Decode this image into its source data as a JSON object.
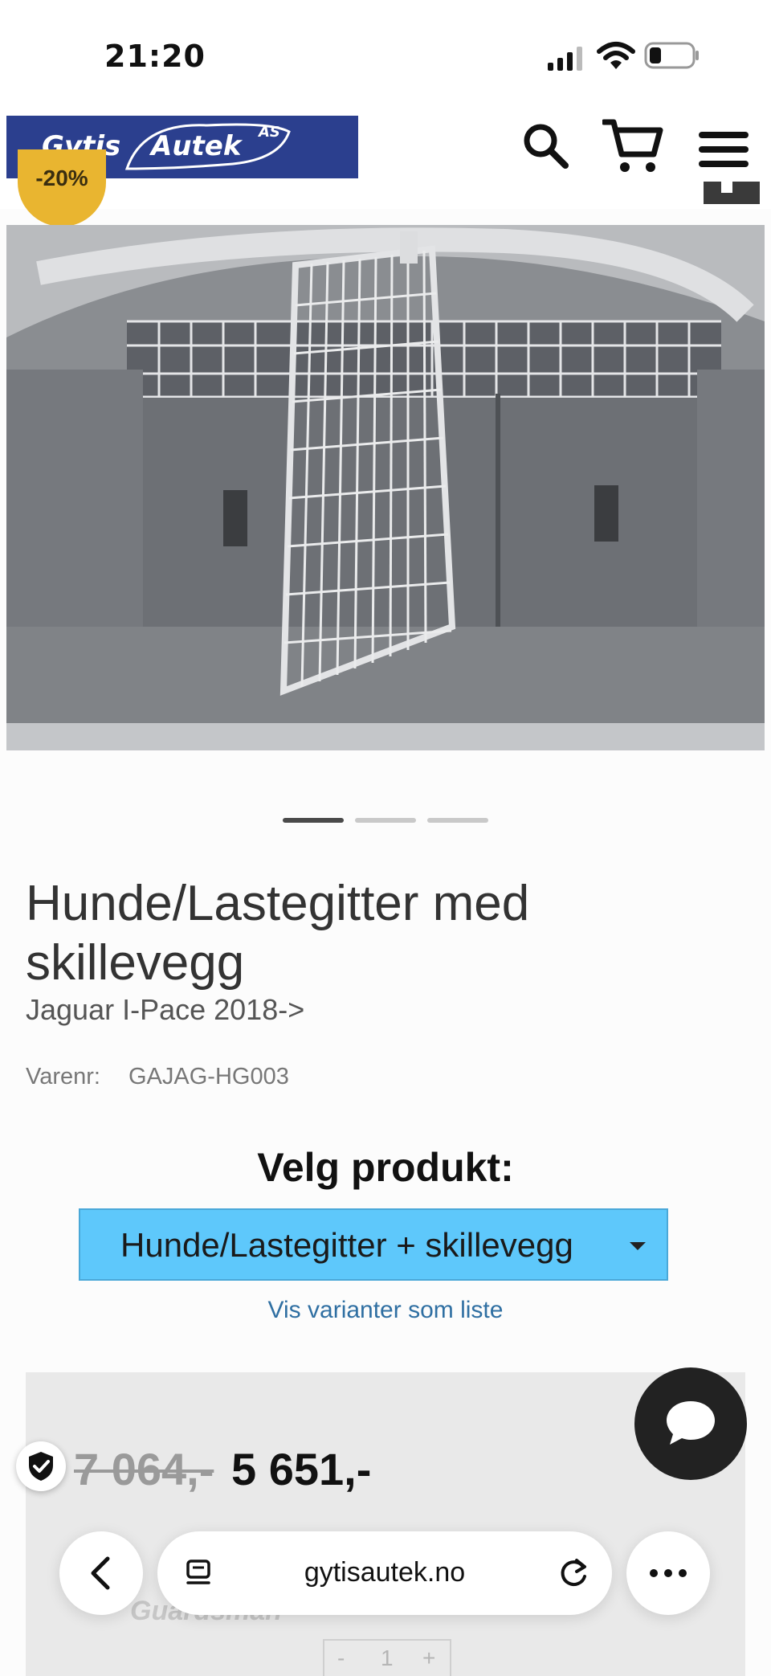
{
  "status_bar": {
    "time": "21:20"
  },
  "header": {
    "logo": {
      "name": "Gytis",
      "name2": "Autek",
      "suffix": "AS",
      "bg_color": "#2b3f8e"
    },
    "icons": [
      "search-icon",
      "cart-icon",
      "menu-icon"
    ]
  },
  "badge": {
    "discount": "-20%",
    "color": "#e9b530"
  },
  "carousel": {
    "slides": 3,
    "active": 1
  },
  "product": {
    "title": "Hunde/Lastegitter med skillevegg",
    "subtitle": "Jaguar I-Pace 2018->",
    "sku_label": "Varenr:",
    "sku_value": "GAJAG-HG003"
  },
  "variant": {
    "label": "Velg produkt:",
    "selected": "Hunde/Lastegitter + skillevegg",
    "list_link": "Vis varianter som liste",
    "color": "#5ec8fb"
  },
  "price": {
    "old": "7 064,-",
    "new": "5 651,-",
    "brand_watermark": "Guardsman",
    "quantity": {
      "minus": "-",
      "value": "1",
      "plus": "+"
    }
  },
  "browser": {
    "url": "gytisautek.no"
  }
}
